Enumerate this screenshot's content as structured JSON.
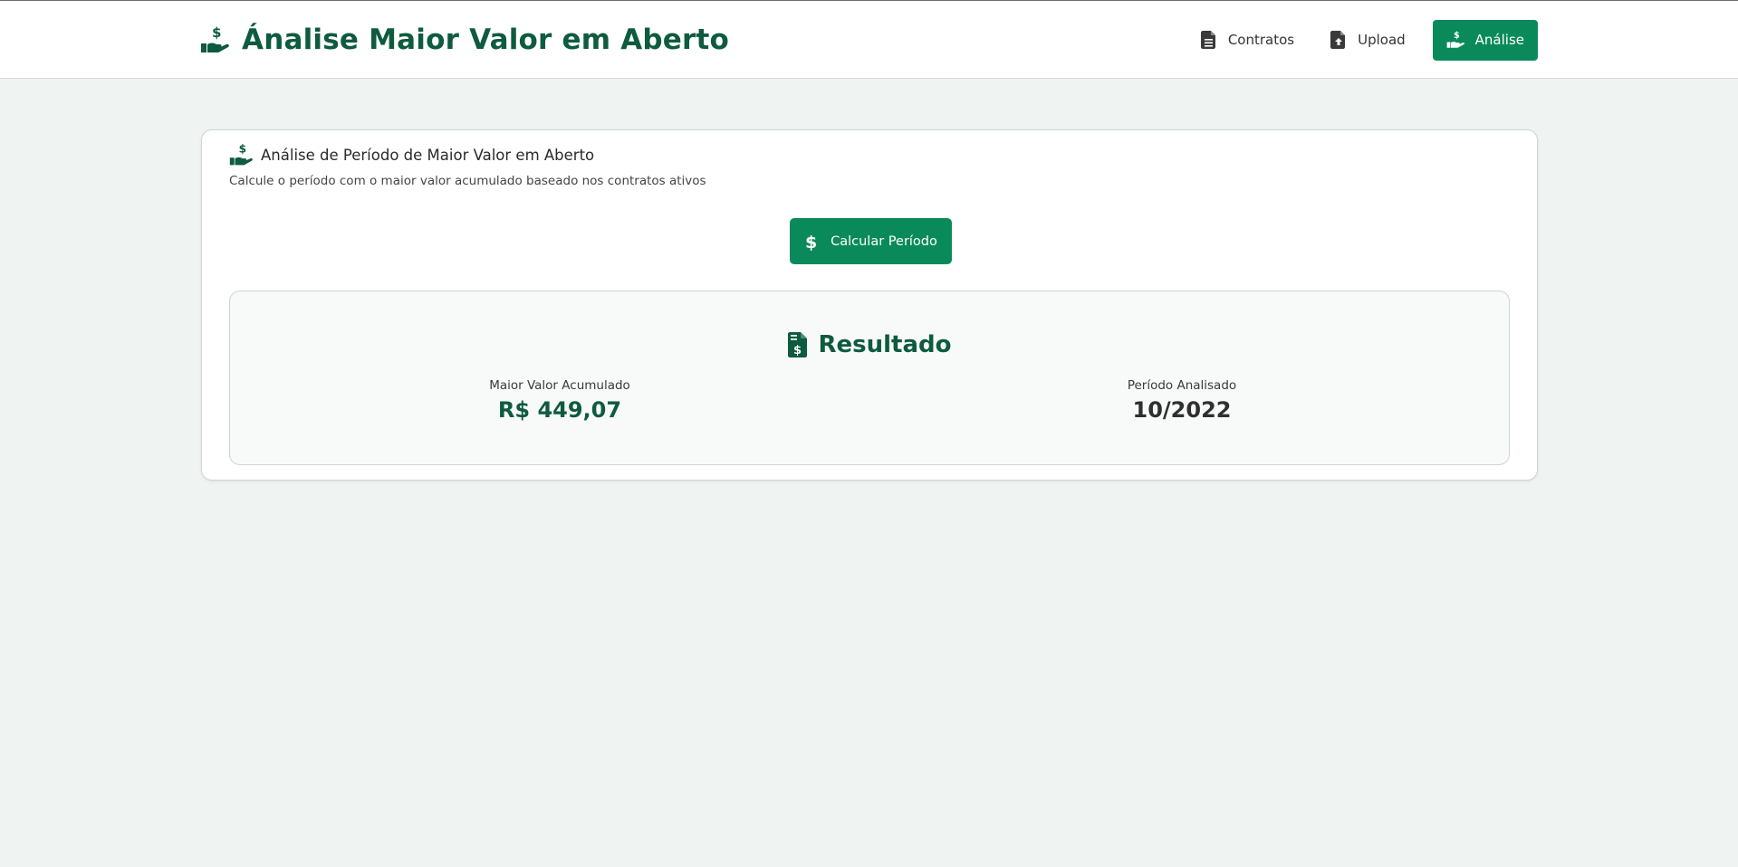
{
  "header": {
    "title": "Ánalise Maior Valor em Aberto",
    "brand_icon": "hand-holding-dollar-icon"
  },
  "nav": {
    "items": [
      {
        "label": "Contratos",
        "icon": "file-icon",
        "active": false
      },
      {
        "label": "Upload",
        "icon": "file-upload-icon",
        "active": false
      },
      {
        "label": "Análise",
        "icon": "hand-holding-dollar-icon",
        "active": true
      }
    ]
  },
  "card": {
    "title": "Análise de Período de Maior Valor em Aberto",
    "subtitle": "Calcule o período com o maior valor acumulado baseado nos contratos ativos",
    "calc_button": "Calcular Período"
  },
  "result": {
    "title": "Resultado",
    "max_label": "Maior Valor Acumulado",
    "max_value": "R$ 449,07",
    "period_label": "Período Analisado",
    "period_value": "10/2022"
  },
  "colors": {
    "primary": "#0a8a5a",
    "primary_dark": "#0e5b3f",
    "background": "#eff3f2"
  }
}
